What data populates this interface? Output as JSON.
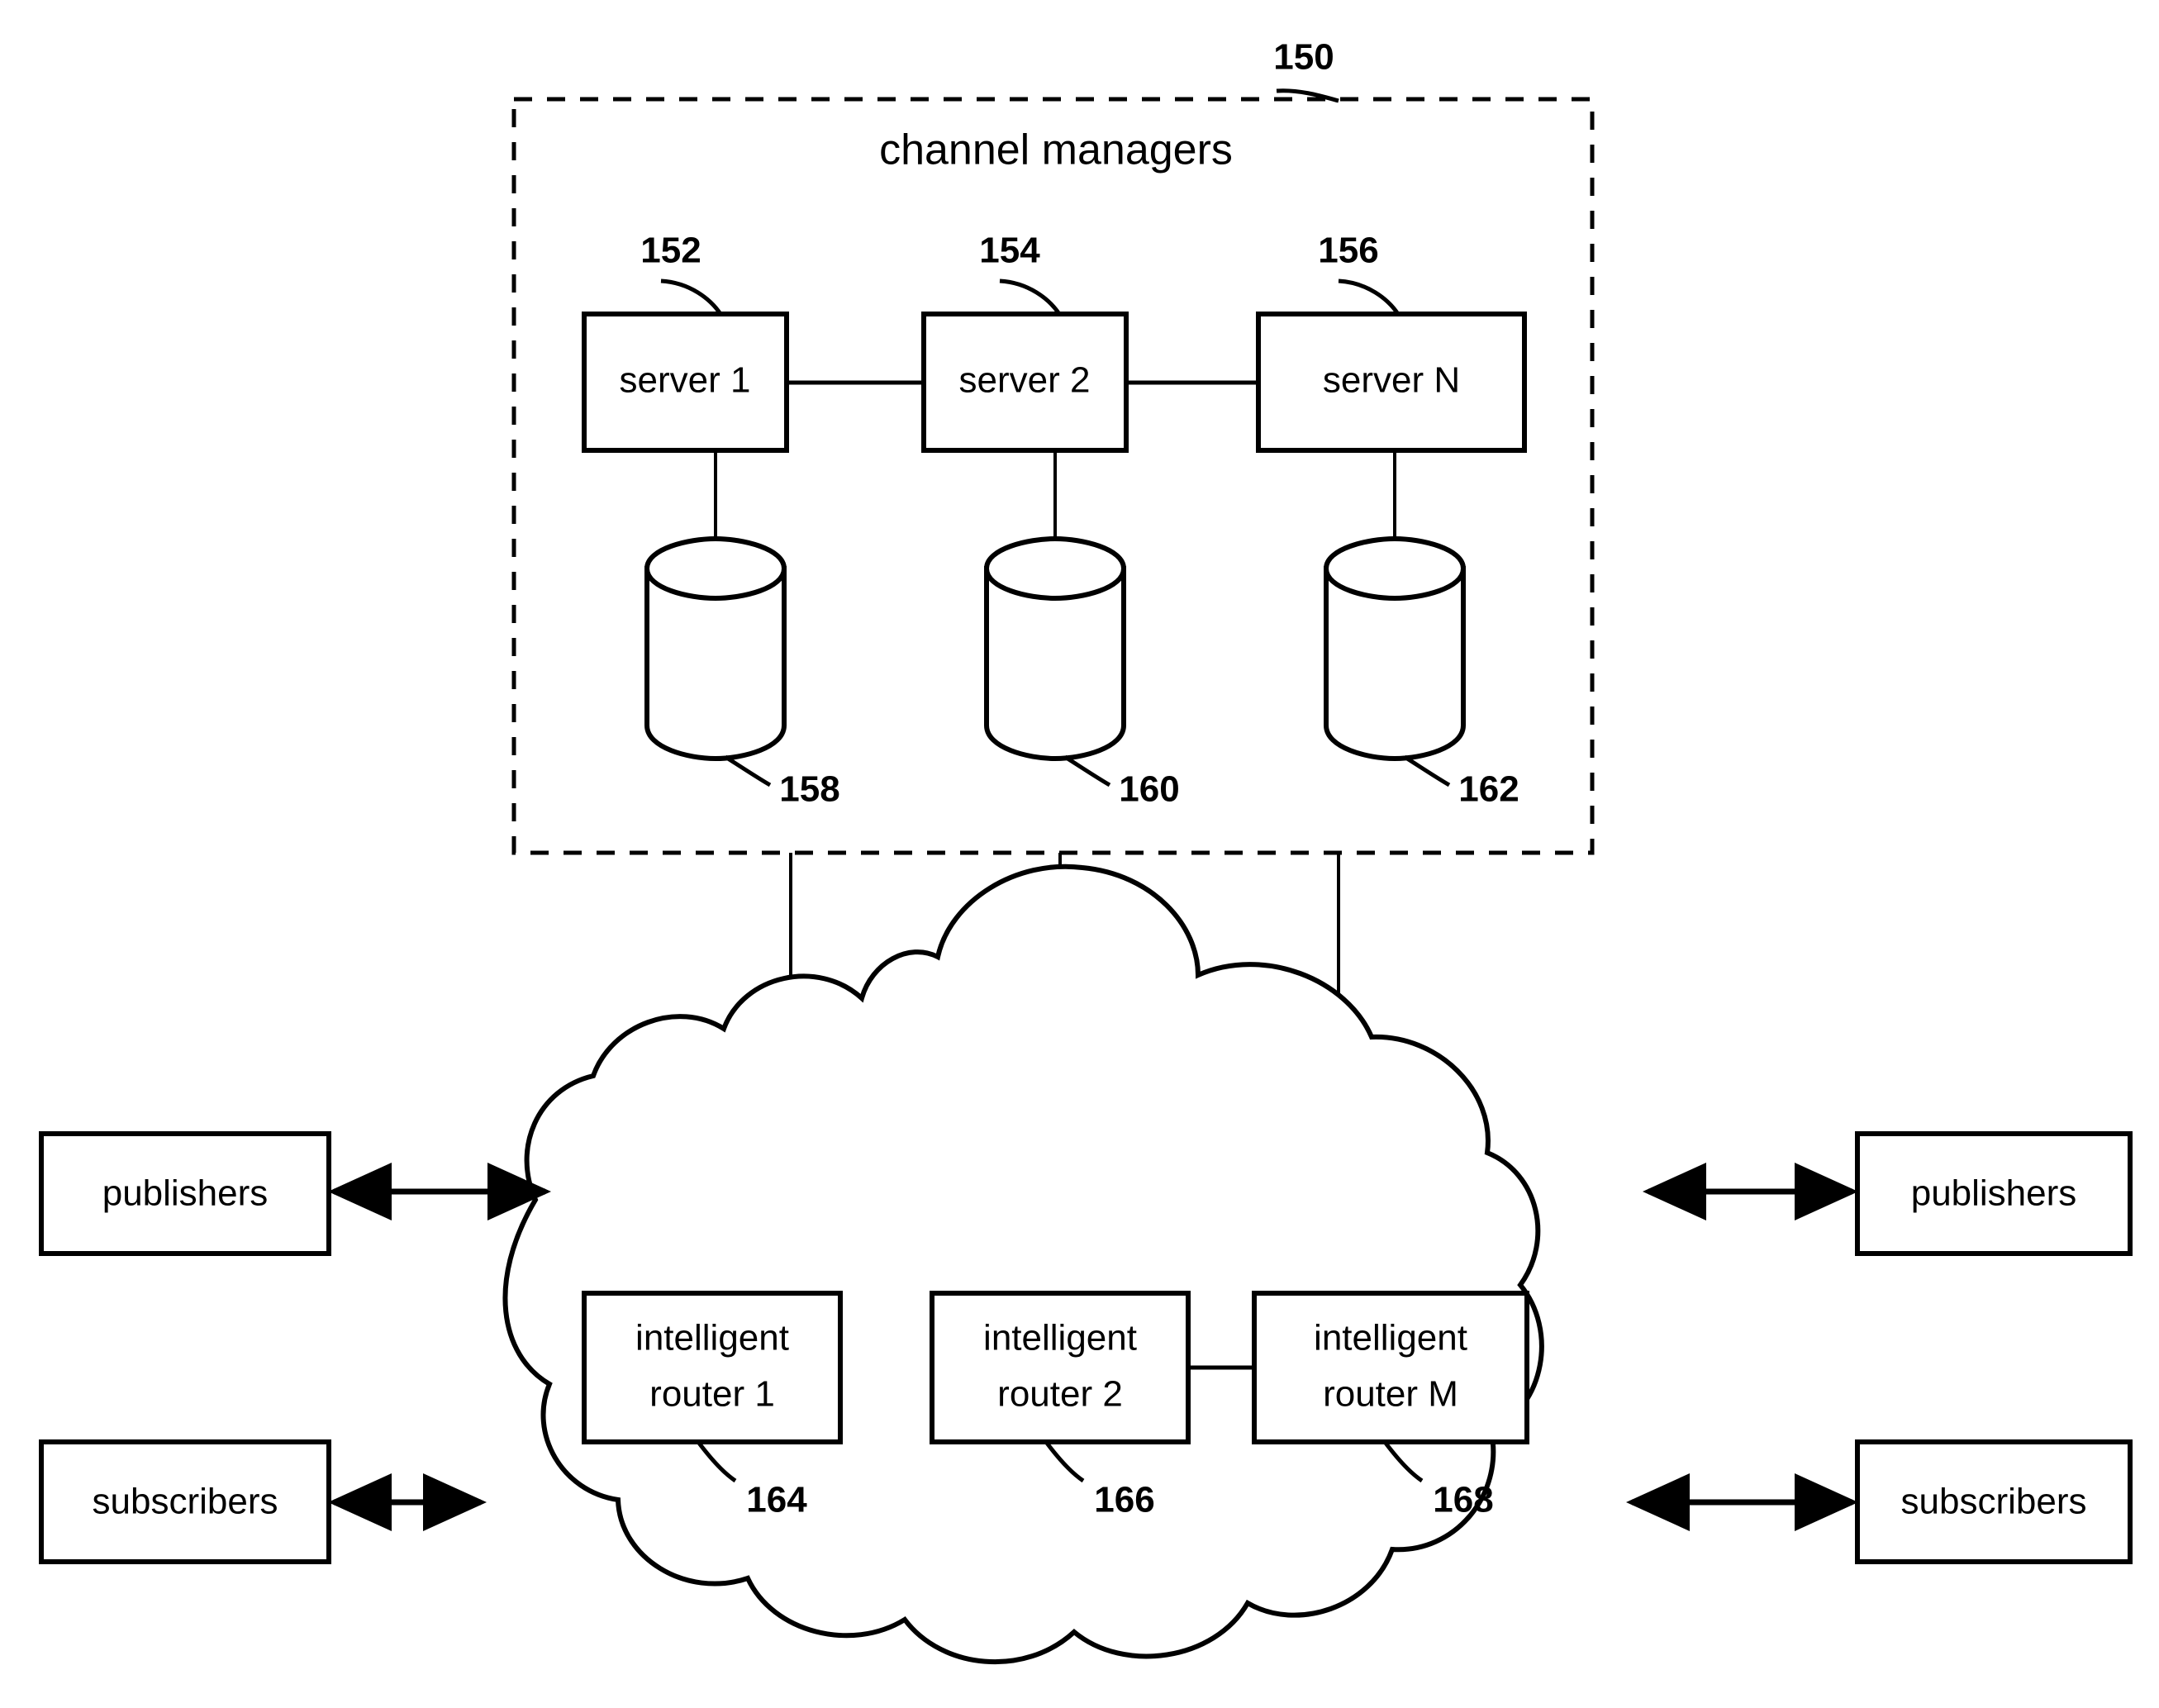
{
  "figure": {
    "type": "patent-diagram",
    "background_color": "#ffffff",
    "line_color": "#000000"
  },
  "group": {
    "title": "channel managers",
    "ref": "150"
  },
  "servers": [
    {
      "label": "server 1",
      "ref": "152"
    },
    {
      "label": "server 2",
      "ref": "154"
    },
    {
      "label": "server N",
      "ref": "156"
    }
  ],
  "databases": [
    {
      "ref": "158"
    },
    {
      "ref": "160"
    },
    {
      "ref": "162"
    }
  ],
  "routers": [
    {
      "label_line1": "intelligent",
      "label_line2": "router 1",
      "ref": "164"
    },
    {
      "label_line1": "intelligent",
      "label_line2": "router 2",
      "ref": "166"
    },
    {
      "label_line1": "intelligent",
      "label_line2": "router M",
      "ref": "168"
    }
  ],
  "endpoints": [
    {
      "label": "publishers",
      "side": "left",
      "row": "top"
    },
    {
      "label": "publishers",
      "side": "right",
      "row": "top"
    },
    {
      "label": "subscribers",
      "side": "left",
      "row": "bottom"
    },
    {
      "label": "subscribers",
      "side": "right",
      "row": "bottom"
    }
  ],
  "icons": {
    "database": "database-cylinder-icon",
    "cloud": "network-cloud-icon",
    "arrow": "double-headed-arrow-icon"
  }
}
